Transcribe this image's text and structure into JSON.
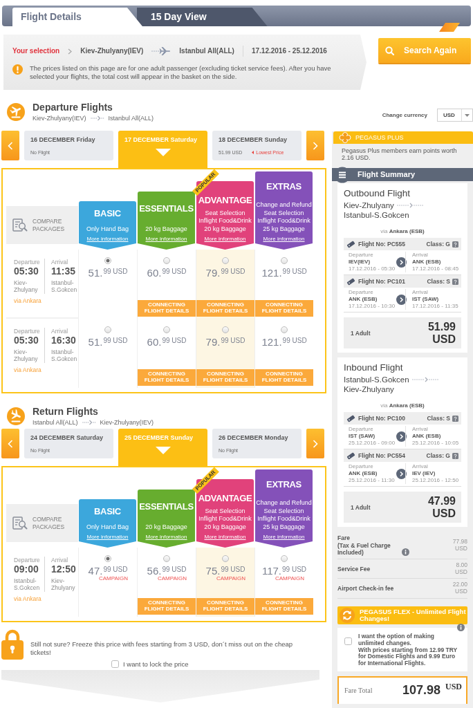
{
  "tabs": [
    {
      "label": "Flight Details",
      "selected": true
    },
    {
      "label": "15 Day View",
      "selected": false
    }
  ],
  "selection": {
    "label": "Your selection",
    "origin": "Kiev-Zhulyany(IEV)",
    "destination": "Istanbul All(ALL)",
    "dates": "17.12.2016 - 25.12.2016",
    "notice": "The prices listed on this page are for one adult passenger (excluding ticket service fees). After you have selected your flights, the total cost will appear in the basket on the side."
  },
  "search_button": {
    "label": "Search Again"
  },
  "currency": {
    "label": "Change currency",
    "value": "USD"
  },
  "sections": [
    {
      "kind": "departure",
      "title": "Departure Flights",
      "origin": "Kiev-Zhulyany(IEV)",
      "destination": "Istanbul All(ALL)",
      "dates": [
        {
          "label": "16 DECEMBER Friday",
          "note": "No Flight",
          "selected": false
        },
        {
          "label": "17 DECEMBER Saturday",
          "selected": true
        },
        {
          "label": "18 DECEMBER Sunday",
          "note": "51.99 USD",
          "badge": "Lowest Price",
          "selected": false
        }
      ],
      "compare_label": "COMPARE PACKAGES",
      "packages": [
        {
          "name": "BASIC",
          "color": "#3ca7dc",
          "features": [
            "Only Hand Bag"
          ],
          "link": "More information"
        },
        {
          "name": "ESSENTIALS",
          "color": "#67ad2f",
          "features": [
            "20 kg Baggage"
          ],
          "link": "More information"
        },
        {
          "name": "ADVANTAGE",
          "color": "#e1427b",
          "ribbon": "POPULAR",
          "features": [
            "Seat Selection",
            "Inflight Food&Drink",
            "20 kg Baggage"
          ],
          "link": "More information"
        },
        {
          "name": "EXTRAS",
          "color": "#8451b9",
          "features": [
            "Change and Refund",
            "Seat Selection",
            "Inflight Food&Drink",
            "25 kg Baggage"
          ],
          "link": "More information"
        }
      ],
      "flights": [
        {
          "departure": {
            "label": "Departure",
            "time": "05:30",
            "city": "Kiev-Zhulyany"
          },
          "arrival": {
            "label": "Arrival",
            "time": "11:35",
            "city": "Istanbul-S.Gokcen"
          },
          "via": "via Ankara",
          "fares": [
            {
              "price": "51.$^{99 USD}$",
              "selected": true
            },
            {
              "price": "60.$^{99 USD}$",
              "selected": false,
              "details": "CONNECTING FLIGHT DETAILS"
            },
            {
              "price": "79.$^{99 USD}$",
              "selected": false,
              "details": "CONNECTING FLIGHT DETAILS"
            },
            {
              "price": "121.$^{99 USD}$",
              "selected": false,
              "details": "CONNECTING FLIGHT DETAILS"
            }
          ]
        },
        {
          "departure": {
            "label": "Departure",
            "time": "05:30",
            "city": "Kiev-Zhulyany"
          },
          "arrival": {
            "label": "Arrival",
            "time": "16:30",
            "city": "Istanbul-S.Gokcen"
          },
          "via": "via Ankara",
          "fares": [
            {
              "price": "51.$^{99 USD}$",
              "selected": false
            },
            {
              "price": "60.$^{99 USD}$",
              "selected": false,
              "details": "CONNECTING FLIGHT DETAILS"
            },
            {
              "price": "79.$^{99 USD}$",
              "selected": false,
              "details": "CONNECTING FLIGHT DETAILS"
            },
            {
              "price": "121.$^{99 USD}$",
              "selected": false,
              "details": "CONNECTING FLIGHT DETAILS"
            }
          ]
        }
      ]
    },
    {
      "kind": "return",
      "title": "Return Flights",
      "origin": "Istanbul All(ALL)",
      "destination": "Kiev-Zhulyany(IEV)",
      "dates": [
        {
          "label": "24 DECEMBER Saturday",
          "note": "No Flight",
          "selected": false
        },
        {
          "label": "25 DECEMBER Sunday",
          "selected": true
        },
        {
          "label": "26 DECEMBER Monday",
          "note": "No Flight",
          "selected": false
        }
      ],
      "compare_label": "COMPARE PACKAGES",
      "packages": [
        {
          "name": "BASIC",
          "color": "#3ca7dc",
          "features": [
            "Only Hand Bag"
          ],
          "link": "More information"
        },
        {
          "name": "ESSENTIALS",
          "color": "#67ad2f",
          "features": [
            "20 kg Baggage"
          ],
          "link": "More information"
        },
        {
          "name": "ADVANTAGE",
          "color": "#e1427b",
          "ribbon": "POPULAR",
          "features": [
            "Seat Selection",
            "Inflight Food&Drink",
            "20 kg Baggage"
          ],
          "link": "More information"
        },
        {
          "name": "EXTRAS",
          "color": "#8451b9",
          "features": [
            "Change and Refund",
            "Seat Selection",
            "Inflight Food&Drink",
            "25 kg Baggage"
          ],
          "link": "More information"
        }
      ],
      "flights": [
        {
          "departure": {
            "label": "Departure",
            "time": "09:00",
            "city": "Istanbul-S.Gokcen"
          },
          "arrival": {
            "label": "Arrival",
            "time": "12:50",
            "city": "Kiev-Zhulyany"
          },
          "via": "via Ankara",
          "fares": [
            {
              "price": "47.$^{99 USD}$",
              "campaign": "CAMPAIGN",
              "selected": true
            },
            {
              "price": "56.$^{99 USD}$",
              "campaign": "CAMPAIGN",
              "selected": false,
              "details": "CONNECTING FLIGHT DETAILS"
            },
            {
              "price": "75.$^{99 USD}$",
              "campaign": "CAMPAIGN",
              "selected": false,
              "details": "CONNECTING FLIGHT DETAILS"
            },
            {
              "price": "117.$^{99 USD}$",
              "campaign": "CAMPAIGN",
              "selected": false,
              "details": "CONNECTING FLIGHT DETAILS"
            }
          ]
        }
      ]
    }
  ],
  "pegasus_plus": {
    "title": "PEGASUS PLUS",
    "text": "Pegasus Plus members earn points worth 2.16 USD."
  },
  "summary": {
    "title": "Flight Summary",
    "flights": [
      {
        "title": "Outbound Flight",
        "origin": "Kiev-Zhulyany",
        "destination": "Istanbul-S.Gokcen",
        "via": "via **Ankara (ESB)**",
        "legs": [
          {
            "flight_no": "Flight No: PC555",
            "class": "Class: G",
            "departure": {
              "label": "Departure",
              "code": "IEV(IEV)",
              "time": "17.12.2016 - 05:30"
            },
            "arrival": {
              "label": "Arrival",
              "code": "ANK (ESB)",
              "time": "17.12.2016 - 08:45"
            }
          },
          {
            "flight_no": "Flight No: PC101",
            "class": "Class: S",
            "departure": {
              "label": "Departure",
              "code": "ANK (ESB)",
              "time": "17.12.2016 - 10:30"
            },
            "arrival": {
              "label": "Arrival",
              "code": "IST (SAW)",
              "time": "17.12.2016 - 11:35"
            }
          }
        ],
        "passengers": "1 Adult",
        "price": "51.99 USD"
      },
      {
        "title": "Inbound Flight",
        "origin": "Istanbul-S.Gokcen",
        "destination": "Kiev-Zhulyany",
        "via": "via **Ankara (ESB)**",
        "legs": [
          {
            "flight_no": "Flight No: PC100",
            "class": "Class: S",
            "departure": {
              "label": "Departure",
              "code": "IST (SAW)",
              "time": "25.12.2016 - 09:00"
            },
            "arrival": {
              "label": "Arrival",
              "code": "ANK (ESB)",
              "time": "25.12.2016 - 10:05"
            }
          },
          {
            "flight_no": "Flight No: PC554",
            "class": "Class: G",
            "departure": {
              "label": "Departure",
              "code": "ANK (ESB)",
              "time": "25.12.2016 - 11:30"
            },
            "arrival": {
              "label": "Arrival",
              "code": "IEV (IEV)",
              "time": "25.12.2016 - 12:50"
            }
          }
        ],
        "passengers": "1 Adult",
        "price": "47.99 USD"
      }
    ],
    "fees": [
      {
        "label": "Fare",
        "note": "(Tax & Fuel Charge Included)",
        "info": true,
        "value": "77.98 USD"
      },
      {
        "label": "Service Fee",
        "info": false,
        "value": "8.00 USD"
      },
      {
        "label": "Airport Check-in fee",
        "info": false,
        "value": "22.00 USD"
      }
    ]
  },
  "flex": {
    "title": "PEGASUS FLEX - Unlimited Flight Changes!",
    "checked": false,
    "label": "I want the option of making unlimited changes.",
    "note": "With prices starting from 12.99 TRY for Domestic Flights and 9.99 Euro for International Flights.",
    "info": true
  },
  "total": {
    "label": "Fare Total",
    "value": "107.98 $^{USD}$"
  },
  "lock": {
    "text": "Still not sure? Freeze this price with fees starting from 3 USD, don´t miss out on the cheap tickets!",
    "checked": false,
    "label": "I want to lock the price"
  }
}
